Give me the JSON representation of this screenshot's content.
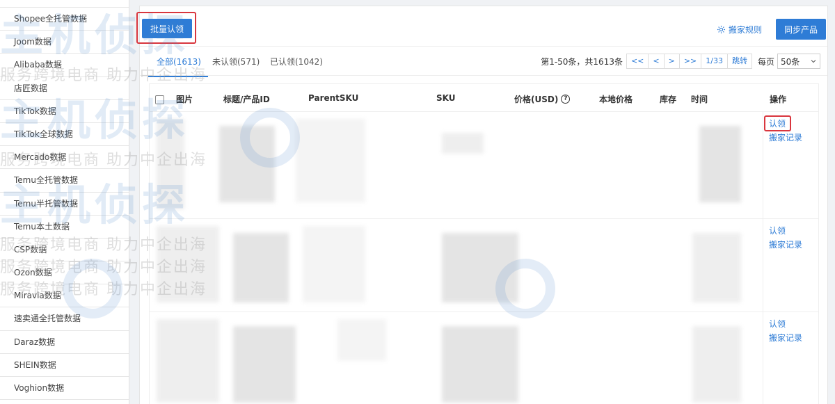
{
  "sidebar": {
    "items": [
      {
        "label": "Shopee全托管数据"
      },
      {
        "label": "Joom数据"
      },
      {
        "label": "Alibaba数据"
      },
      {
        "label": "店匠数据"
      },
      {
        "label": "TikTok数据"
      },
      {
        "label": "TikTok全球数据"
      },
      {
        "label": "Mercado数据"
      },
      {
        "label": "Temu全托管数据"
      },
      {
        "label": "Temu半托管数据"
      },
      {
        "label": "Temu本土数据"
      },
      {
        "label": "CSP数据"
      },
      {
        "label": "Ozon数据"
      },
      {
        "label": "Miravia数据"
      },
      {
        "label": "速卖通全托管数据"
      },
      {
        "label": "Daraz数据"
      },
      {
        "label": "SHEIN数据"
      },
      {
        "label": "Voghion数据"
      }
    ]
  },
  "toolbar": {
    "bulk_claim_label": "批量认领",
    "rule_label": "搬家规则",
    "sync_label": "同步产品"
  },
  "tabs": [
    {
      "label": "全部(1613)",
      "active": true
    },
    {
      "label": "未认领(571)",
      "active": false
    },
    {
      "label": "已认领(1042)",
      "active": false
    }
  ],
  "pagination": {
    "info": "第1-50条，共1613条",
    "first": "<<",
    "prev": "<",
    "next": ">",
    "last": ">>",
    "page": "1/33",
    "jump": "跳转",
    "per_page_label": "每页",
    "per_page_value": "50条"
  },
  "table": {
    "columns": {
      "image": "图片",
      "title": "标题/产品ID",
      "parent_sku": "ParentSKU",
      "sku": "SKU",
      "price": "价格(USD)",
      "local_price": "本地价格",
      "stock": "库存",
      "time": "时间",
      "ops": "操作"
    },
    "rows": [
      {
        "claim": "认领",
        "record": "搬家记录"
      },
      {
        "claim": "认领",
        "record": "搬家记录"
      },
      {
        "claim": "认领",
        "record": "搬家记录"
      }
    ]
  },
  "watermark": {
    "logo": "主机侦探",
    "slogan": "服务跨境电商 助力中企出海"
  },
  "colors": {
    "primary": "#2e7cd6",
    "highlight": "#d9363e"
  }
}
